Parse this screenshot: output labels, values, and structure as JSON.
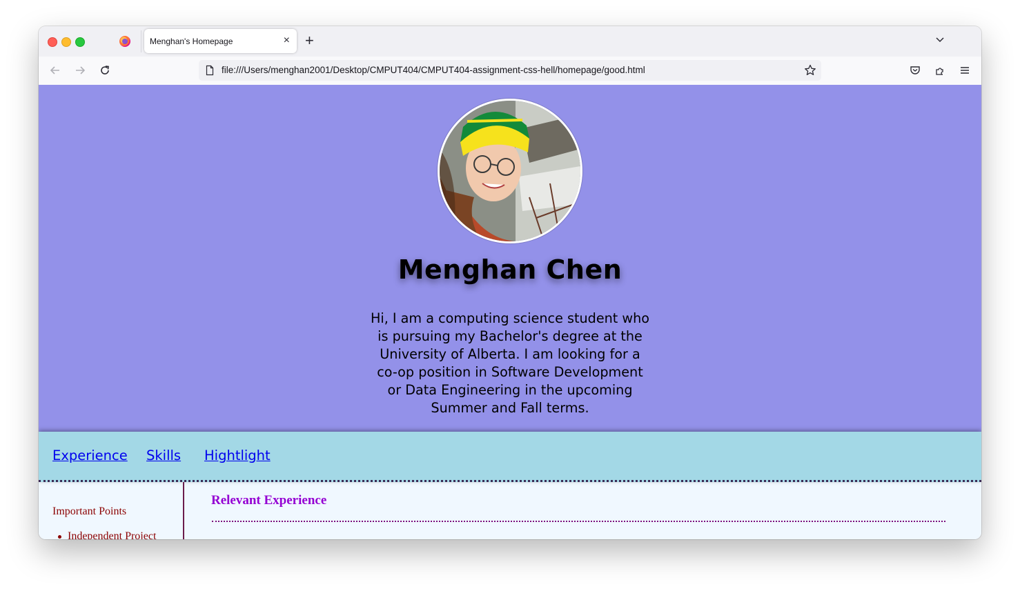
{
  "browser": {
    "tab_title": "Menghan's Homepage",
    "tab_close": "×",
    "new_tab": "+",
    "url": "file:///Users/menghan2001/Desktop/CMPUT404/CMPUT404-assignment-css-hell/homepage/good.html",
    "icons": [
      "back-arrow-icon",
      "forward-arrow-icon",
      "reload-icon",
      "page-icon",
      "bookmark-star-icon",
      "pocket-icon",
      "extensions-icon",
      "menu-icon",
      "tab-list-chevron-icon",
      "firefox-icon"
    ]
  },
  "hero": {
    "name": "Menghan Chen",
    "bio": "Hi, I am a computing science student who is pursuing my Bachelor's degree at the University of Alberta. I am looking for a co-op position in Software Development or Data Engineering in the upcoming Summer and Fall terms.",
    "background": "#9391e9"
  },
  "nav": {
    "links": [
      "Experience",
      "Skills",
      "Hightlight"
    ],
    "background": "#a3d8e6"
  },
  "sidebar": {
    "title": "Important Points",
    "items": [
      "Independent Project"
    ]
  },
  "main": {
    "heading": "Relevant Experience"
  }
}
